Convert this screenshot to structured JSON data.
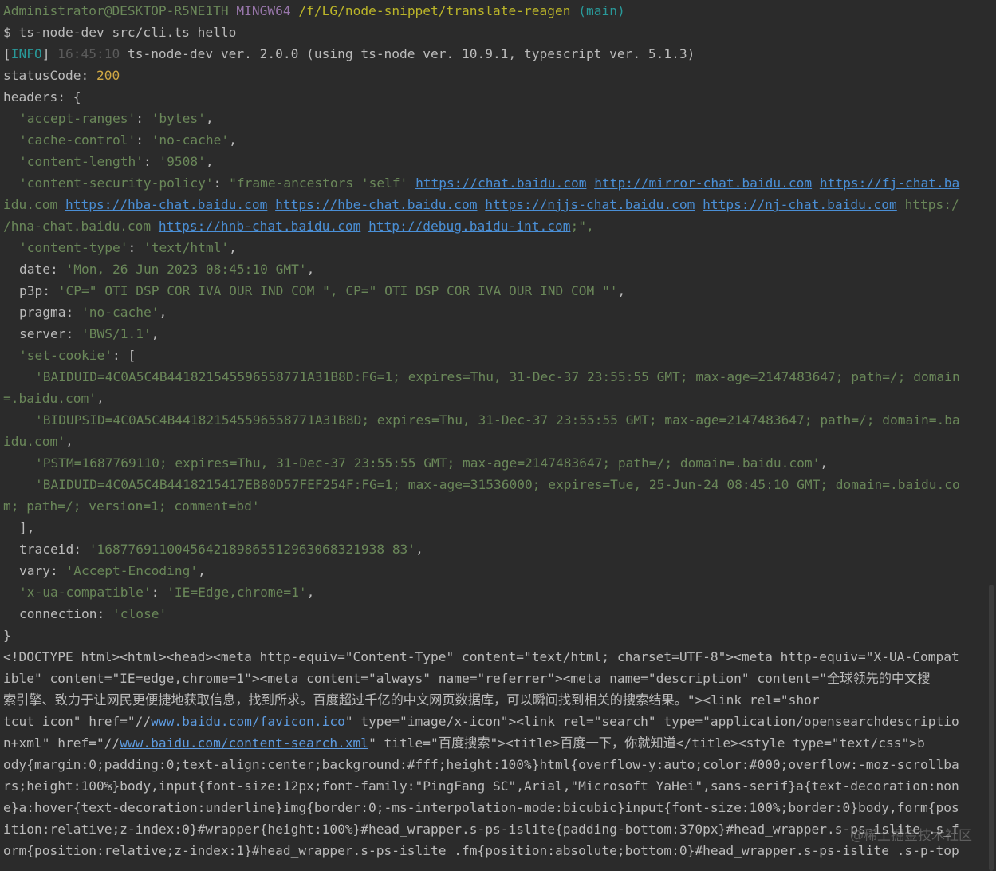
{
  "prompt": {
    "user": "Administrator@DESKTOP-R5NE1TH",
    "app": "MINGW64",
    "path": "/f/LG/node-snippet/translate-reagen",
    "branch": "(main)"
  },
  "command": "$ ts-node-dev src/cli.ts hello",
  "info": {
    "tag_open": "[",
    "tag": "INFO",
    "tag_close": "]",
    "time": "16:45:10",
    "message": "ts-node-dev ver. 2.0.0 (using ts-node ver. 10.9.1, typescript ver. 5.1.3)"
  },
  "status": {
    "label": "statusCode: ",
    "value": "200"
  },
  "headers_open": "headers: {",
  "headers": {
    "accept_ranges": {
      "key": "'accept-ranges'",
      "value": "'bytes'"
    },
    "cache_control": {
      "key": "'cache-control'",
      "value": "'no-cache'"
    },
    "content_length": {
      "key": "'content-length'",
      "value": "'9508'"
    },
    "csp_key": "'content-security-policy'",
    "csp_prefix": "\"frame-ancestors 'self' ",
    "csp_links": [
      "https://chat.baidu.com",
      "http://mirror-chat.baidu.com",
      "https://fj-chat.ba",
      "idu.com",
      "https://hba-chat.baidu.com",
      "https://hbe-chat.baidu.com",
      "https://njjs-chat.baidu.com",
      "https://nj-chat.baidu.com",
      "https:/",
      "/hna-chat.baidu.com",
      "https://hnb-chat.baidu.com",
      "http://debug.baidu-int.com"
    ],
    "csp_suffix": ";\",",
    "content_type": {
      "key": "'content-type'",
      "value": "'text/html'"
    },
    "date": {
      "key": "date",
      "value": "'Mon, 26 Jun 2023 08:45:10 GMT'"
    },
    "p3p": {
      "key": "p3p",
      "value": "'CP=\" OTI DSP COR IVA OUR IND COM \", CP=\" OTI DSP COR IVA OUR IND COM \"'"
    },
    "pragma": {
      "key": "pragma",
      "value": "'no-cache'"
    },
    "server": {
      "key": "server",
      "value": "'BWS/1.1'"
    },
    "set_cookie_key": "'set-cookie'",
    "set_cookie": [
      "'BAIDUID=4C0A5C4B441821545596558771A31B8D:FG=1; expires=Thu, 31-Dec-37 23:55:55 GMT; max-age=2147483647; path=/; domain",
      "=.baidu.com'",
      "'BIDUPSID=4C0A5C4B441821545596558771A31B8D; expires=Thu, 31-Dec-37 23:55:55 GMT; max-age=2147483647; path=/; domain=.ba",
      "idu.com'",
      "'PSTM=1687769110; expires=Thu, 31-Dec-37 23:55:55 GMT; max-age=2147483647; path=/; domain=.baidu.com'",
      "'BAIDUID=4C0A5C4B4418215417EB80D57FEF254F:FG=1; max-age=31536000; expires=Tue, 25-Jun-24 08:45:10 GMT; domain=.baidu.co",
      "m; path=/; version=1; comment=bd'"
    ],
    "traceid": {
      "key": "traceid",
      "value": "'1687769110045642189865512963068321938 83'"
    },
    "vary": {
      "key": "vary",
      "value": "'Accept-Encoding'"
    },
    "x_ua_compatible": {
      "key": "'x-ua-compatible'",
      "value": "'IE=Edge,chrome=1'"
    },
    "connection": {
      "key": "connection",
      "value": "'close'"
    }
  },
  "body_lines": {
    "l1": "<!DOCTYPE html><html><head><meta http-equiv=\"Content-Type\" content=\"text/html; charset=UTF-8\"><meta http-equiv=\"X-UA-Compat",
    "l2": "ible\" content=\"IE=edge,chrome=1\"><meta content=\"always\" name=\"referrer\"><meta name=\"description\" content=\"全球领先的中文搜",
    "l3": "索引擎、致力于让网民更便捷地获取信息，找到所求。百度超过千亿的中文网页数据库，可以瞬间找到相关的搜索结果。\"><link rel=\"shor",
    "l4_a": "tcut icon\" href=\"//",
    "l4_link": "www.baidu.com/favicon.ico",
    "l4_b": "\" type=\"image/x-icon\"><link rel=\"search\" type=\"application/opensearchdescriptio",
    "l5_a": "n+xml\" href=\"//",
    "l5_link": "www.baidu.com/content-search.xml",
    "l5_b": "\" title=\"百度搜索\"><title>百度一下，你就知道</title><style type=\"text/css\">b",
    "l6": "ody{margin:0;padding:0;text-align:center;background:#fff;height:100%}html{overflow-y:auto;color:#000;overflow:-moz-scrollba",
    "l7": "rs;height:100%}body,input{font-size:12px;font-family:\"PingFang SC\",Arial,\"Microsoft YaHei\",sans-serif}a{text-decoration:non",
    "l8": "e}a:hover{text-decoration:underline}img{border:0;-ms-interpolation-mode:bicubic}input{font-size:100%;border:0}body,form{pos",
    "l9": "ition:relative;z-index:0}#wrapper{height:100%}#head_wrapper.s-ps-islite{padding-bottom:370px}#head_wrapper.s-ps-islite .s_f",
    "l10": "orm{position:relative;z-index:1}#head_wrapper.s-ps-islite .fm{position:absolute;bottom:0}#head_wrapper.s-ps-islite .s-p-top"
  },
  "watermark": "@稀土掘金技术社区"
}
